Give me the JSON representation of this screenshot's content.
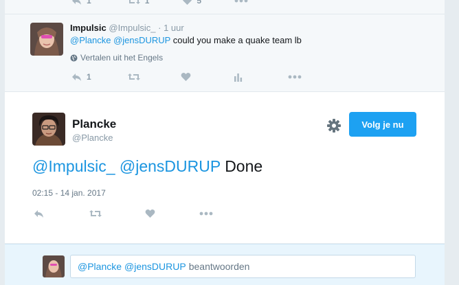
{
  "top_strip": {
    "reply_count": "1",
    "retweet_count": "1",
    "like_count": "5"
  },
  "parent_tweet": {
    "name": "Impulsic",
    "handle": "@Impulsic_",
    "separator": "·",
    "time": "1 uur",
    "mention_1": "@Plancke",
    "mention_2": "@jensDURUP",
    "text": "could you make a quake team lb",
    "translate_label": "Vertalen uit het Engels",
    "reply_count": "1"
  },
  "main_tweet": {
    "name": "Plancke",
    "handle": "@Plancke",
    "follow_label": "Volg je nu",
    "mention_1": "@Impulsic_",
    "mention_2": "@jensDURUP",
    "text": "Done",
    "datetime": "02:15 - 14 jan. 2017"
  },
  "reply_bar": {
    "mention_1": "@Plancke",
    "mention_2": "@jensDURUP",
    "placeholder": "beantwoorden"
  },
  "colors": {
    "link": "#1b95e0",
    "button": "#1da1f2",
    "muted": "#8899a6",
    "page_bg": "#e6ecf0"
  },
  "icons": [
    "reply-icon",
    "retweet-icon",
    "like-icon",
    "analytics-icon",
    "more-icon",
    "globe-icon",
    "gear-icon"
  ]
}
